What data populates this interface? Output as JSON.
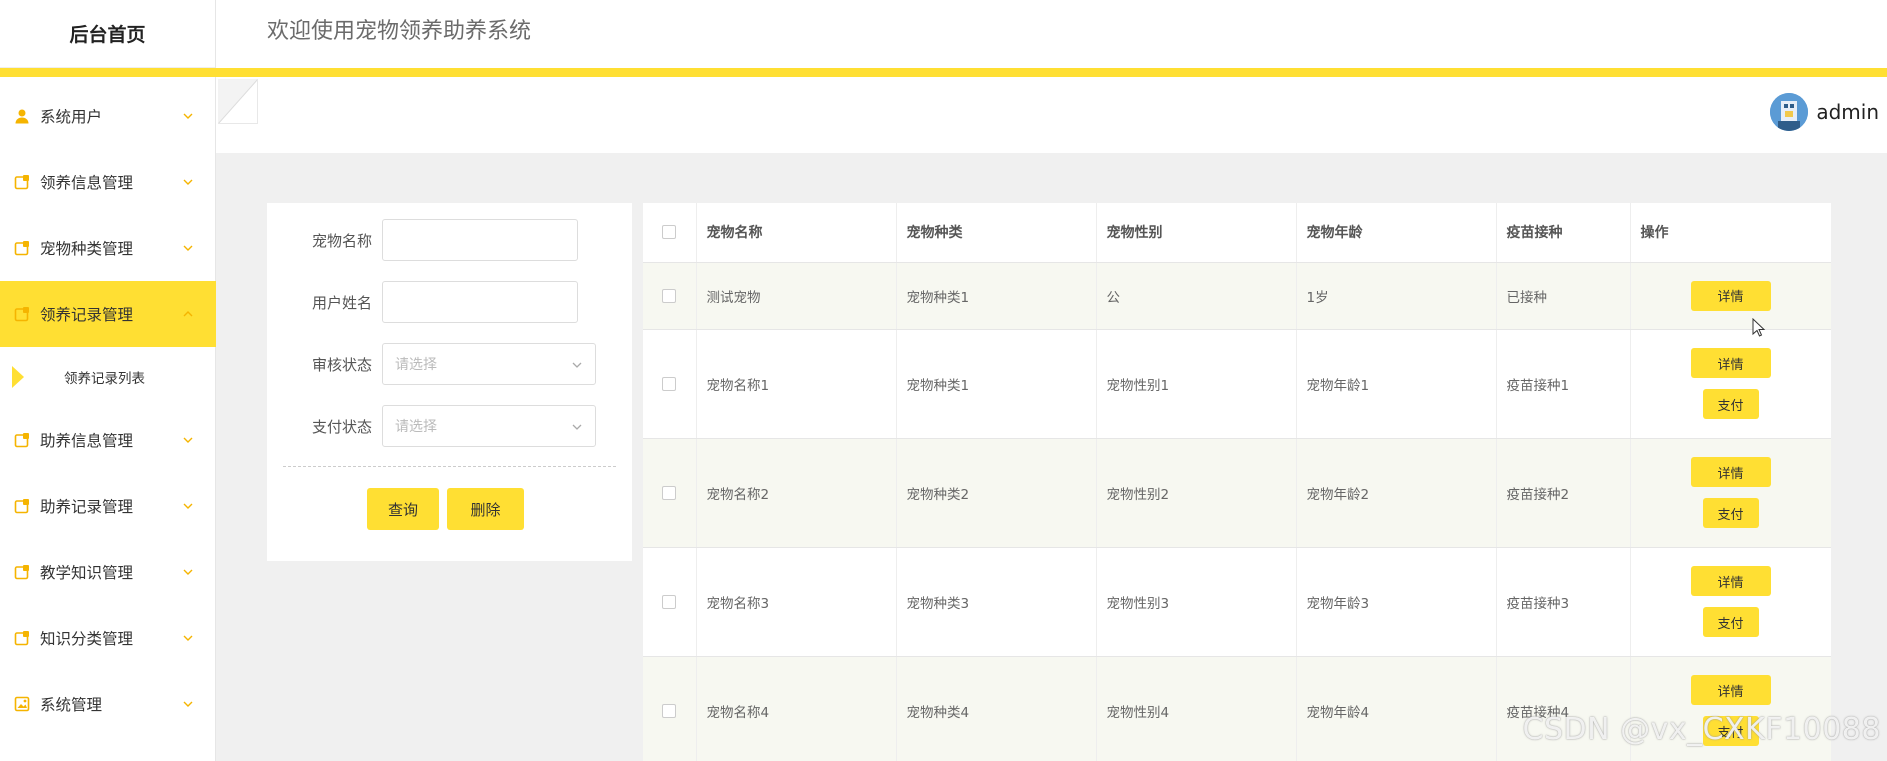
{
  "sidebar": {
    "logo": "后台首页",
    "menu": [
      {
        "label": "系统用户",
        "icon": "user-icon",
        "active": false
      },
      {
        "label": "领养信息管理",
        "icon": "module-icon",
        "active": false
      },
      {
        "label": "宠物种类管理",
        "icon": "module-icon",
        "active": false
      },
      {
        "label": "领养记录管理",
        "icon": "module-icon",
        "active": true,
        "expanded": true
      },
      {
        "label": "助养信息管理",
        "icon": "module-icon",
        "active": false
      },
      {
        "label": "助养记录管理",
        "icon": "module-icon",
        "active": false
      },
      {
        "label": "教学知识管理",
        "icon": "module-icon",
        "active": false
      },
      {
        "label": "知识分类管理",
        "icon": "module-icon",
        "active": false
      },
      {
        "label": "系统管理",
        "icon": "image-icon",
        "active": false
      }
    ],
    "submenu": {
      "label": "领养记录列表"
    }
  },
  "header": {
    "title": "欢迎使用宠物领养助养系统",
    "user": "admin"
  },
  "search": {
    "pet_name_label": "宠物名称",
    "user_name_label": "用户姓名",
    "audit_status_label": "审核状态",
    "audit_status_placeholder": "请选择",
    "pay_status_label": "支付状态",
    "pay_status_placeholder": "请选择",
    "query_button": "查询",
    "delete_button": "删除"
  },
  "table": {
    "headers": [
      "宠物名称",
      "宠物种类",
      "宠物性别",
      "宠物年龄",
      "疫苗接种",
      "操作"
    ],
    "detail_label": "详情",
    "pay_label": "支付",
    "rows": [
      {
        "name": "测试宠物",
        "type": "宠物种类1",
        "gender": "公",
        "age": "1岁",
        "vaccine": "已接种",
        "pay": false
      },
      {
        "name": "宠物名称1",
        "type": "宠物种类1",
        "gender": "宠物性别1",
        "age": "宠物年龄1",
        "vaccine": "疫苗接种1",
        "pay": true
      },
      {
        "name": "宠物名称2",
        "type": "宠物种类2",
        "gender": "宠物性别2",
        "age": "宠物年龄2",
        "vaccine": "疫苗接种2",
        "pay": true
      },
      {
        "name": "宠物名称3",
        "type": "宠物种类3",
        "gender": "宠物性别3",
        "age": "宠物年龄3",
        "vaccine": "疫苗接种3",
        "pay": true
      },
      {
        "name": "宠物名称4",
        "type": "宠物种类4",
        "gender": "宠物性别4",
        "age": "宠物年龄4",
        "vaccine": "疫苗接种4",
        "pay": true
      }
    ]
  },
  "watermark": "CSDN @vx_CXKF10088",
  "colors": {
    "accent": "#ffdf33",
    "icon": "#f5b400"
  }
}
